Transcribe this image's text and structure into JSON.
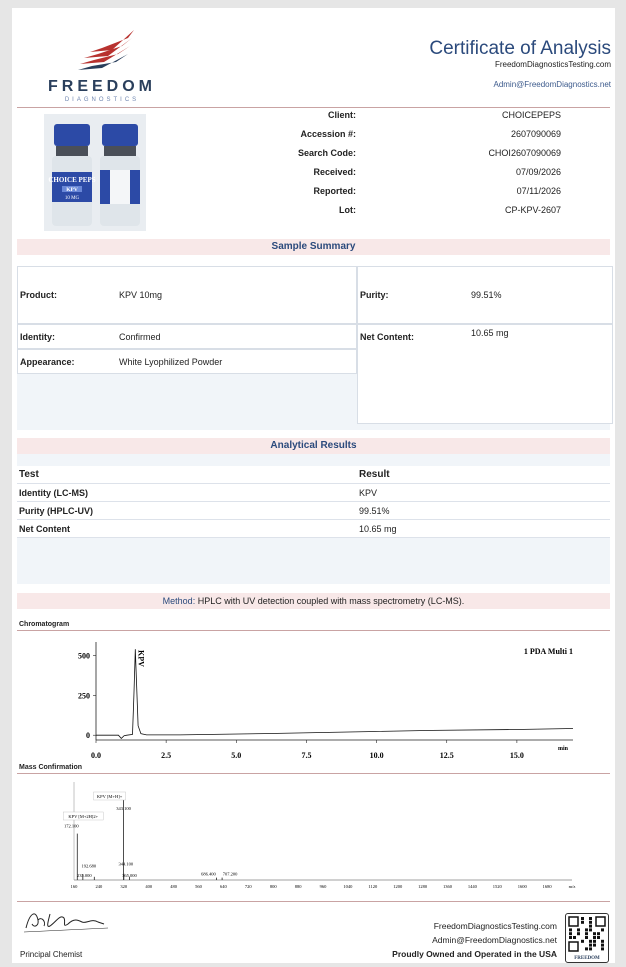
{
  "brand": {
    "name": "FREEDOM",
    "subname": "DIAGNOSTICS",
    "colors": {
      "navy": "#2a3f5c",
      "red": "#b8322f",
      "accent": "#2b4a7c"
    }
  },
  "header": {
    "title": "Certificate of Analysis",
    "website": "FreedomDiagnosticsTesting.com",
    "email": "Admin@FreedomDiagnostics.net"
  },
  "product_image": {
    "vial_label_brand": "CHOICE PEPS",
    "vial_label_product": "KPV",
    "vial_label_amount": "10 MG"
  },
  "info": [
    {
      "label": "Client:",
      "value": "CHOICEPEPS"
    },
    {
      "label": "Accession #:",
      "value": "2607090069"
    },
    {
      "label": "Search Code:",
      "value": "CHOI2607090069"
    },
    {
      "label": "Received:",
      "value": "07/09/2026"
    },
    {
      "label": "Reported:",
      "value": "07/11/2026"
    },
    {
      "label": "Lot:",
      "value": "CP-KPV-2607"
    }
  ],
  "summary": {
    "title": "Sample Summary",
    "product_label": "Product:",
    "product_value": "KPV 10mg",
    "purity_label": "Purity:",
    "purity_value": "99.51%",
    "identity_label": "Identity:",
    "identity_value": "Confirmed",
    "net_label": "Net Content:",
    "net_value": "10.65 mg",
    "appearance_label": "Appearance:",
    "appearance_value": "White Lyophilized Powder"
  },
  "analytical": {
    "title": "Analytical Results",
    "col_test": "Test",
    "col_result": "Result",
    "rows": [
      {
        "test": "Identity (LC-MS)",
        "result": "KPV"
      },
      {
        "test": "Purity (HPLC-UV)",
        "result": "99.51%"
      },
      {
        "test": "Net Content",
        "result": "10.65 mg"
      }
    ]
  },
  "method": {
    "label": "Method:",
    "text": "HPLC with UV detection coupled with mass spectrometry (LC-MS)."
  },
  "chart_data": [
    {
      "type": "line",
      "title": "Chromatogram",
      "legend": "1 PDA Multi 1",
      "peak_label": "KPV",
      "x_unit": "min",
      "x_ticks": [
        "0.0",
        "2.5",
        "5.0",
        "7.5",
        "10.0",
        "12.5",
        "15.0"
      ],
      "y_ticks": [
        "500",
        "250",
        "0"
      ],
      "xlim": [
        0,
        17
      ],
      "ylim": [
        -30,
        560
      ],
      "x": [
        0,
        0.8,
        0.9,
        1.0,
        1.1,
        1.3,
        1.35,
        1.4,
        1.45,
        1.5,
        1.6,
        1.8,
        3,
        6,
        9,
        12,
        15,
        17
      ],
      "y": [
        0,
        0,
        -20,
        -3,
        0,
        5,
        250,
        540,
        300,
        60,
        10,
        2,
        2,
        10,
        20,
        30,
        36,
        42
      ]
    },
    {
      "type": "bar",
      "title": "Mass Confirmation",
      "x_unit": "m/z",
      "xlim": [
        160,
        2000
      ],
      "x_ticks": [
        "160",
        "240",
        "320",
        "400",
        "480",
        "560",
        "640",
        "720",
        "800",
        "880",
        "960",
        "1040",
        "1120",
        "1200",
        "1280",
        "1360",
        "1440",
        "1520",
        "1600",
        "1680",
        "m/z"
      ],
      "peaks": [
        {
          "mz": 172.1,
          "intensity": 0.58,
          "label": "172.100"
        },
        {
          "mz": 192.68,
          "intensity": 0.07,
          "label": "192.680"
        },
        {
          "mz": 235.0,
          "intensity": 0.04,
          "label": "235.000"
        },
        {
          "mz": 343.1,
          "intensity": 1.0,
          "label": "343.100"
        },
        {
          "mz": 344.1,
          "intensity": 0.08,
          "label": "344.100"
        },
        {
          "mz": 365.0,
          "intensity": 0.04,
          "label": "365.000"
        },
        {
          "mz": 686.4,
          "intensity": 0.03,
          "label": "686.400"
        },
        {
          "mz": 707.2,
          "intensity": 0.03,
          "label": "707.200"
        }
      ],
      "annotations": [
        "KPV [M+H]+",
        "KPV [M+2H]2+"
      ]
    }
  ],
  "footer": {
    "signature": "Alex Johnson",
    "role": "Principal Chemist",
    "website": "FreedomDiagnosticsTesting.com",
    "email": "Admin@FreedomDiagnostics.net",
    "tagline": "Proudly Owned and Operated in the USA",
    "qr_brand": "FREEDOM"
  }
}
